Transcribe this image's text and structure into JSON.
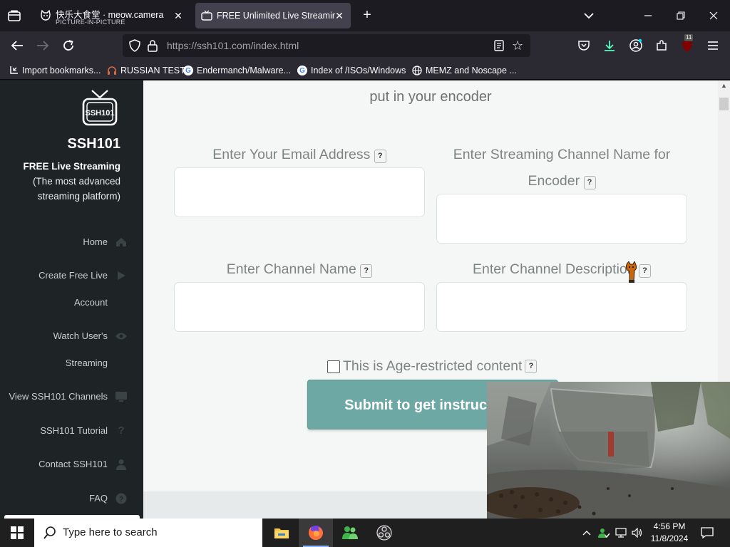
{
  "browser": {
    "tabs": [
      {
        "title": "快乐大食堂 · meow.camera",
        "subtitle": "PICTURE-IN-PICTURE",
        "active": false
      },
      {
        "title": "FREE Unlimited Live Streaming.",
        "active": true
      }
    ],
    "url_host": "https://ssh101.com",
    "url_path": "/index.html",
    "extension_badge": "11",
    "bookmarks": [
      {
        "label": "Import bookmarks...",
        "icon": "import-icon"
      },
      {
        "label": "RUSSIAN TEST",
        "icon": "headphones-icon"
      },
      {
        "label": "Endermanch/Malware...",
        "icon": "google-icon"
      },
      {
        "label": "Index of /ISOs/Windows",
        "icon": "google-icon"
      },
      {
        "label": "MEMZ and Noscape ...",
        "icon": "globe-icon"
      }
    ]
  },
  "sidebar": {
    "brand": "SSH101",
    "logo_text": "SSH101",
    "tagline_bold": "FREE Live Streaming",
    "tagline_rest": "(The most advanced\nstreaming platform)",
    "items": [
      {
        "label": "Home",
        "icon": "home-icon"
      },
      {
        "label": "Create Free Live\nAccount",
        "icon": "play-icon"
      },
      {
        "label": "Watch User's\nStreaming",
        "icon": "eye-icon"
      },
      {
        "label": "View SSH101 Channels",
        "icon": "monitor-icon"
      },
      {
        "label": "SSH101 Tutorial",
        "icon": "question-icon"
      },
      {
        "label": "Contact SSH101",
        "icon": "user-icon"
      },
      {
        "label": "FAQ",
        "icon": "help-circle-icon"
      }
    ]
  },
  "form": {
    "intro": "put in your encoder",
    "email_label": "Enter Your Email Address",
    "stream_name_label": "Enter Streaming Channel Name for Encoder",
    "channel_name_label": "Enter Channel Name",
    "channel_desc_label": "Enter Channel Description",
    "help_mark": "?",
    "email_value": "",
    "stream_name_value": "",
    "channel_name_value": "",
    "channel_desc_value": "",
    "age_restricted_label": "This is Age-restricted content",
    "age_restricted_checked": false,
    "submit_label": "Submit to get instructions"
  },
  "taskbar": {
    "search_placeholder": "Type here to search",
    "time": "4:56 PM",
    "date": "11/8/2024",
    "apps": [
      "file-explorer-icon",
      "firefox-icon",
      "people-icon",
      "obs-icon"
    ]
  }
}
